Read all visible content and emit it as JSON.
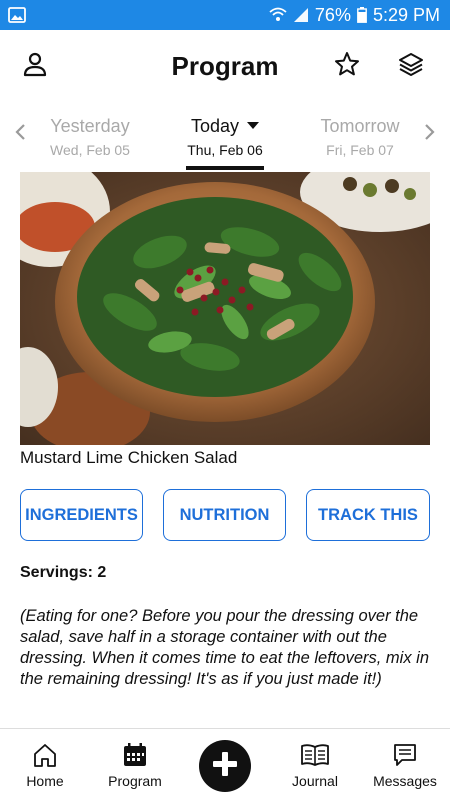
{
  "status_bar": {
    "battery": "76%",
    "time": "5:29 PM"
  },
  "app_bar": {
    "title": "Program"
  },
  "date_nav": {
    "prev": {
      "label": "Yesterday",
      "date": "Wed, Feb 05"
    },
    "current": {
      "label": "Today",
      "date": "Thu, Feb 06"
    },
    "next": {
      "label": "Tomorrow",
      "date": "Fri, Feb 07"
    }
  },
  "recipe": {
    "title": "Mustard Lime Chicken Salad",
    "servings_label": "Servings:",
    "servings_value": "2",
    "note": "(Eating for one? Before you pour the dressing over the salad, save half in a storage container with out the dressing. When it comes time to eat the leftovers, mix in the remaining dressing! It's as if you just made it!)"
  },
  "actions": {
    "ingredients": "INGREDIENTS",
    "nutrition": "NUTRITION",
    "track": "TRACK THIS"
  },
  "bottom_nav": {
    "home": "Home",
    "program": "Program",
    "journal": "Journal",
    "messages": "Messages"
  },
  "colors": {
    "status_bar": "#1e88e5",
    "accent": "#1e6fd9",
    "inactive": "#a9a9a9"
  }
}
